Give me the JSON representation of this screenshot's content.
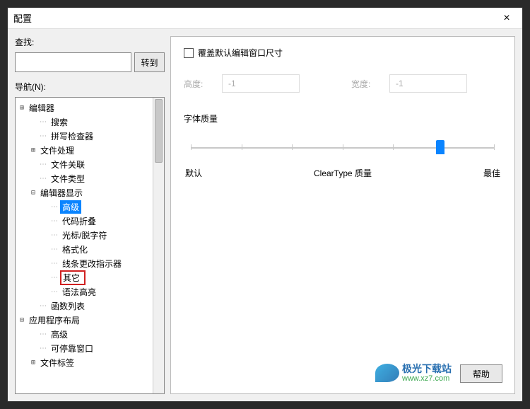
{
  "window": {
    "title": "配置",
    "close": "×"
  },
  "search": {
    "label": "查找:",
    "value": "",
    "goto": "转到"
  },
  "nav": {
    "label": "导航(N):",
    "items": [
      {
        "toggle": "⊞",
        "label": "编辑器",
        "indent": 0
      },
      {
        "toggle": "",
        "label": "搜索",
        "indent": 1,
        "dots": true
      },
      {
        "toggle": "",
        "label": "拼写检查器",
        "indent": 1,
        "dots": true
      },
      {
        "toggle": "⊞",
        "label": "文件处理",
        "indent": 1
      },
      {
        "toggle": "",
        "label": "文件关联",
        "indent": 1,
        "dots": true
      },
      {
        "toggle": "",
        "label": "文件类型",
        "indent": 1,
        "dots": true
      },
      {
        "toggle": "⊟",
        "label": "编辑器显示",
        "indent": 1
      },
      {
        "toggle": "",
        "label": "高级",
        "indent": 2,
        "dots": true,
        "selected": true
      },
      {
        "toggle": "",
        "label": "代码折叠",
        "indent": 2,
        "dots": true
      },
      {
        "toggle": "",
        "label": "光标/脱字符",
        "indent": 2,
        "dots": true
      },
      {
        "toggle": "",
        "label": "格式化",
        "indent": 2,
        "dots": true
      },
      {
        "toggle": "",
        "label": "线条更改指示器",
        "indent": 2,
        "dots": true
      },
      {
        "toggle": "",
        "label": "其它",
        "indent": 2,
        "dots": true,
        "highlighted": true
      },
      {
        "toggle": "",
        "label": "语法高亮",
        "indent": 2,
        "dots": true
      },
      {
        "toggle": "",
        "label": "函数列表",
        "indent": 1,
        "dots": true
      },
      {
        "toggle": "⊟",
        "label": "应用程序布局",
        "indent": 0
      },
      {
        "toggle": "",
        "label": "高级",
        "indent": 1,
        "dots": true
      },
      {
        "toggle": "",
        "label": "可停靠窗口",
        "indent": 1,
        "dots": true
      },
      {
        "toggle": "⊞",
        "label": "文件标签",
        "indent": 1
      }
    ]
  },
  "panel": {
    "override_checkbox": "覆盖默认编辑窗口尺寸",
    "height_label": "高度:",
    "height_value": "-1",
    "width_label": "宽度:",
    "width_value": "-1",
    "font_quality_title": "字体质量",
    "slider": {
      "min_label": "默认",
      "mid_label": "ClearType 质量",
      "max_label": "最佳",
      "pos_pct": 82
    }
  },
  "footer": {
    "help": "帮助"
  },
  "watermark": {
    "name": "极光下载站",
    "url": "www.xz7.com"
  }
}
